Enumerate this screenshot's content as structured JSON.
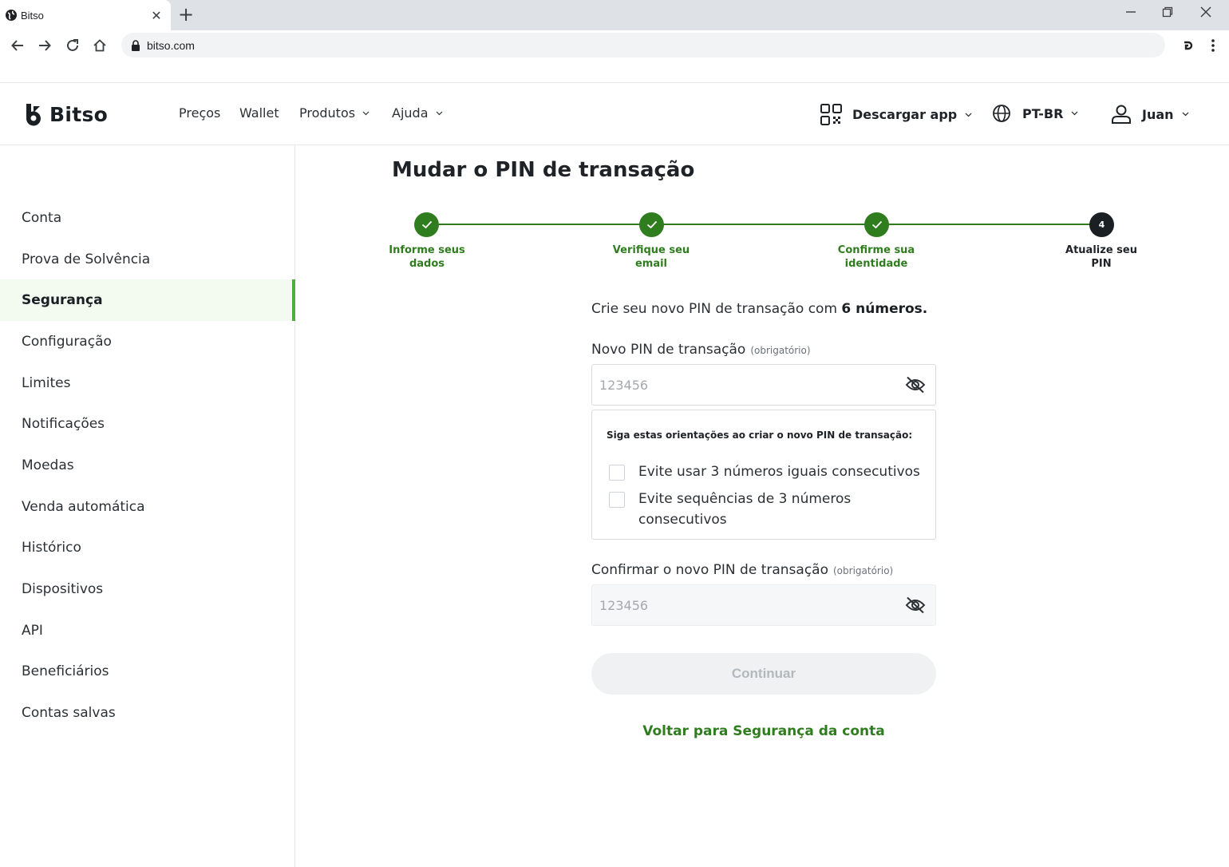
{
  "browser": {
    "tab_title": "Bitso",
    "url": "bitso.com"
  },
  "header": {
    "logo_text": "Bitso",
    "nav": [
      {
        "label": "Preços"
      },
      {
        "label": "Wallet"
      },
      {
        "label": "Produtos"
      },
      {
        "label": "Ajuda"
      }
    ],
    "download_app": "Descargar app",
    "language": "PT-BR",
    "user": "Juan"
  },
  "sidebar": {
    "items": [
      {
        "label": "Conta"
      },
      {
        "label": "Prova de Solvência"
      },
      {
        "label": "Segurança",
        "active": true
      },
      {
        "label": "Configuração"
      },
      {
        "label": "Limites"
      },
      {
        "label": "Notificações"
      },
      {
        "label": "Moedas"
      },
      {
        "label": "Venda automática"
      },
      {
        "label": "Histórico"
      },
      {
        "label": "Dispositivos"
      },
      {
        "label": "API"
      },
      {
        "label": "Beneficiários"
      },
      {
        "label": "Contas salvas"
      }
    ]
  },
  "main": {
    "title": "Mudar o PIN de transação",
    "steps": [
      {
        "line1": "Informe seus",
        "line2": "dados",
        "status": "done"
      },
      {
        "line1": "Verifique seu",
        "line2": "email",
        "status": "done"
      },
      {
        "line1": "Confirme sua",
        "line2": "identidade",
        "status": "done"
      },
      {
        "line1": "Atualize seu",
        "line2": "PIN",
        "status": "current",
        "number": "4"
      }
    ],
    "intro_prefix": "Crie seu novo PIN de transação com ",
    "intro_bold": "6 números.",
    "new_pin": {
      "label": "Novo PIN de transação",
      "required": "(obrigatório)",
      "placeholder": "123456",
      "value": ""
    },
    "rules": {
      "title": "Siga estas orientações ao criar o novo PIN de transação:",
      "items": [
        {
          "text": "Evite usar 3 números iguais consecutivos"
        },
        {
          "text": "Evite sequências de 3 números consecutivos"
        }
      ]
    },
    "confirm_pin": {
      "label": "Confirmar o novo PIN de transação",
      "required": "(obrigatório)",
      "placeholder": "123456",
      "value": ""
    },
    "continue_label": "Continuar",
    "back_link": "Voltar para Segurança da conta"
  },
  "colors": {
    "brand_green": "#2f7d1e",
    "active_bar": "#4caf3d",
    "active_bg": "#f3fbf1"
  }
}
